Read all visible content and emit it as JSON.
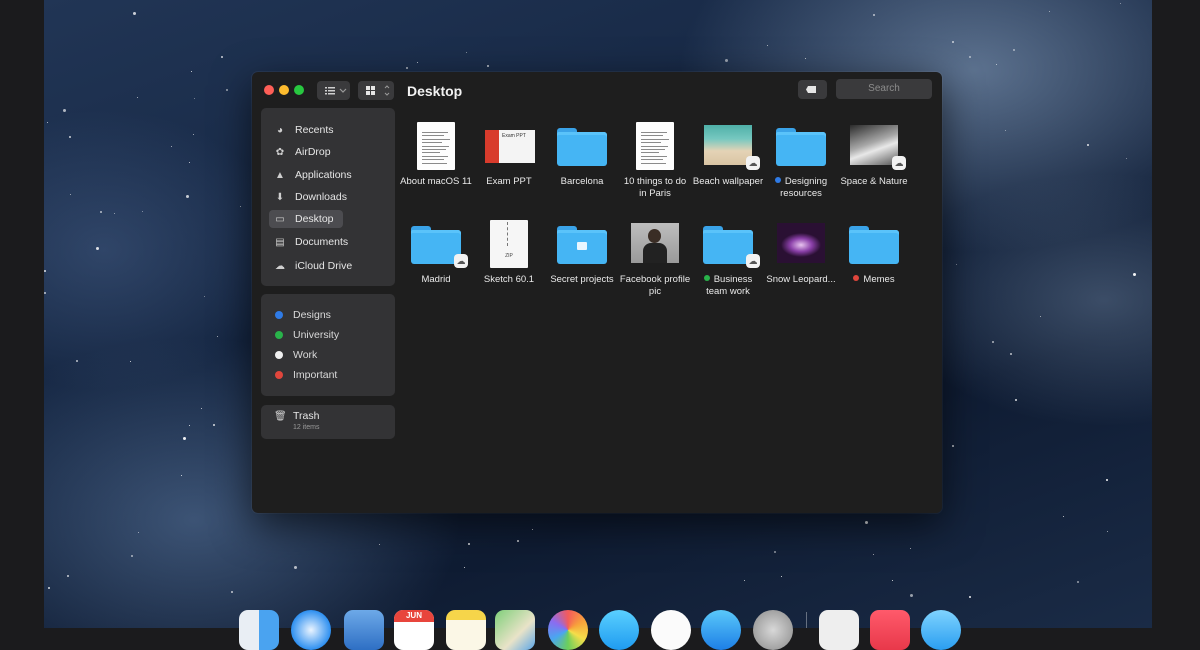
{
  "window": {
    "title": "Desktop",
    "search_placeholder": "Search"
  },
  "sidebar": {
    "nav": [
      {
        "label": "Recents",
        "icon": "clock-icon"
      },
      {
        "label": "AirDrop",
        "icon": "airdrop-icon"
      },
      {
        "label": "Applications",
        "icon": "applications-icon"
      },
      {
        "label": "Downloads",
        "icon": "download-icon"
      },
      {
        "label": "Desktop",
        "icon": "desktop-icon",
        "selected": true
      },
      {
        "label": "Documents",
        "icon": "document-icon"
      },
      {
        "label": "iCloud Drive",
        "icon": "cloud-icon"
      }
    ],
    "tags": [
      {
        "label": "Designs",
        "color": "#2f7be6"
      },
      {
        "label": "University",
        "color": "#29b34a"
      },
      {
        "label": "Work",
        "color": "#f0f0f0"
      },
      {
        "label": "Important",
        "color": "#e0463c"
      }
    ],
    "trash": {
      "label": "Trash",
      "count": "12 items"
    }
  },
  "files": [
    {
      "name": "About macOS 11",
      "kind": "document"
    },
    {
      "name": "Exam PPT",
      "kind": "presentation",
      "thumb_title": "Exam PPT"
    },
    {
      "name": "Barcelona",
      "kind": "folder"
    },
    {
      "name": "10 things to do in Paris",
      "kind": "document"
    },
    {
      "name": "Beach wallpaper",
      "kind": "image",
      "icloud": true
    },
    {
      "name": "Designing resources",
      "kind": "folder",
      "tag_color": "#2f7be6"
    },
    {
      "name": "Space & Nature",
      "kind": "image",
      "icloud": true
    },
    {
      "name": "Madrid",
      "kind": "folder",
      "icloud": true
    },
    {
      "name": "Sketch 60.1",
      "kind": "zip",
      "thumb_label": "ZIP"
    },
    {
      "name": "Secret projects",
      "kind": "folder-locked"
    },
    {
      "name": "Facebook profile pic",
      "kind": "image"
    },
    {
      "name": "Business team work",
      "kind": "folder",
      "icloud": true,
      "tag_color": "#29b34a"
    },
    {
      "name": "Snow Leopard...",
      "kind": "image"
    },
    {
      "name": "Memes",
      "kind": "folder",
      "tag_color": "#e0463c"
    }
  ],
  "dock": {
    "items": [
      "finder-icon",
      "safari-icon",
      "preview-icon",
      "calendar-icon",
      "notes-icon",
      "maps-icon",
      "photos-icon",
      "messages-icon",
      "music-icon",
      "app-store-icon",
      "system-preferences-icon",
      "documents-stack-icon",
      "news-icon",
      "download-stack-icon"
    ],
    "calendar_month": "JUN"
  }
}
